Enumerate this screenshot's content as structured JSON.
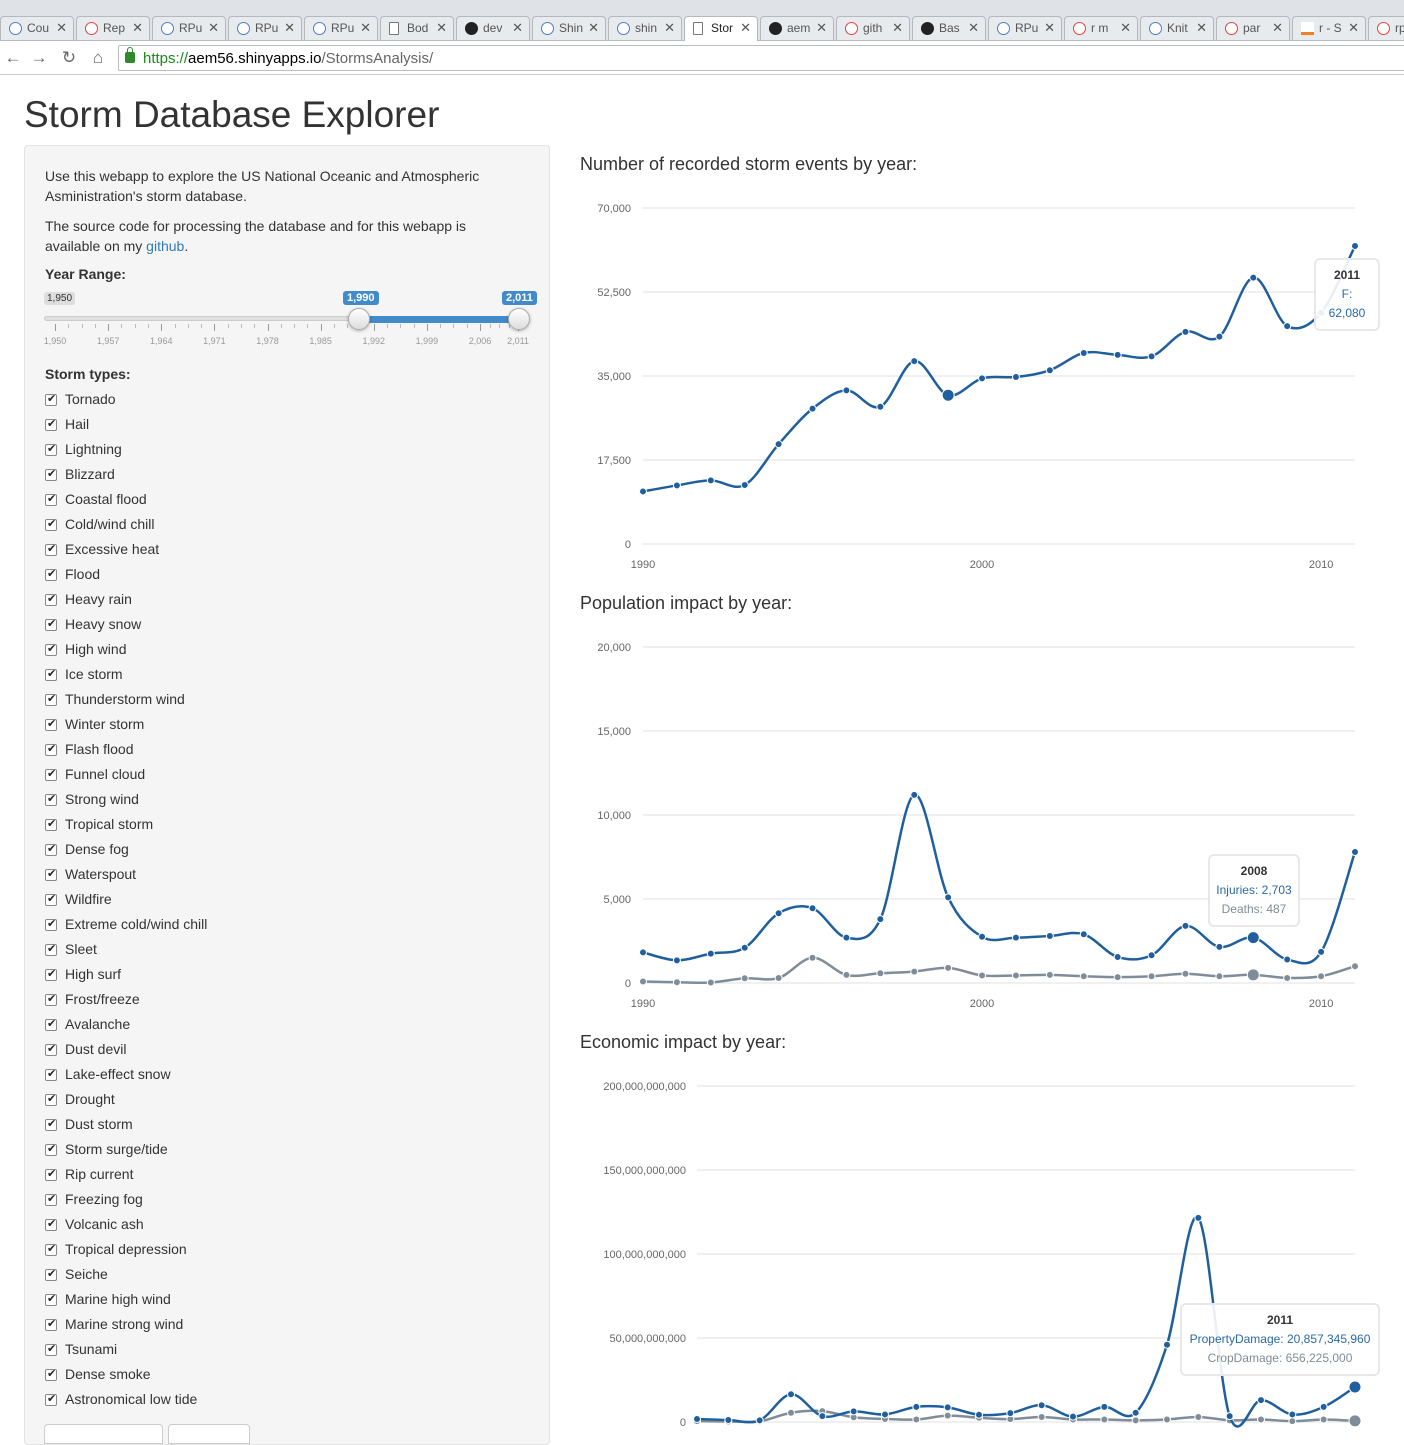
{
  "browser": {
    "tabs": [
      {
        "label": "Cou",
        "icon": "infinity-icon"
      },
      {
        "label": "Rep",
        "icon": "google-icon"
      },
      {
        "label": "RPu",
        "icon": "rstudio-icon"
      },
      {
        "label": "RPu",
        "icon": "rstudio-icon"
      },
      {
        "label": "RPu",
        "icon": "rstudio-icon"
      },
      {
        "label": "Bod",
        "icon": "document-icon"
      },
      {
        "label": "dev",
        "icon": "github-icon"
      },
      {
        "label": "Shin",
        "icon": "rstudio-icon"
      },
      {
        "label": "shin",
        "icon": "rstudio-icon"
      },
      {
        "label": "Stor",
        "icon": "document-icon",
        "active": true
      },
      {
        "label": "aem",
        "icon": "github-icon"
      },
      {
        "label": "gith",
        "icon": "google-icon"
      },
      {
        "label": "Bas",
        "icon": "github-icon"
      },
      {
        "label": "RPu",
        "icon": "rstudio-icon"
      },
      {
        "label": "r m",
        "icon": "google-icon"
      },
      {
        "label": "Knit",
        "icon": "knitr-icon"
      },
      {
        "label": "par",
        "icon": "google-icon"
      },
      {
        "label": "r - S",
        "icon": "stackoverflow-icon"
      },
      {
        "label": "rpr",
        "icon": "google-icon"
      }
    ],
    "url_scheme": "https://",
    "url_host": "aem56.shinyapps.io",
    "url_path": "/StormsAnalysis/"
  },
  "page": {
    "title": "Storm Database Explorer",
    "intro1": "Use this webapp to explore the US National Oceanic and Atmospheric Asministration's storm database.",
    "intro2_prefix": "The source code for processing the database and for this webapp is available on my ",
    "intro2_link": "github",
    "intro2_suffix": "."
  },
  "slider": {
    "label": "Year Range:",
    "min_label": "1,950",
    "max_label": "2,011",
    "from_label": "1,990",
    "to_label": "2,011",
    "min": 1950,
    "max": 2011,
    "from": 1990,
    "to": 2011,
    "grid_labels": [
      "1,950",
      "1,957",
      "1,964",
      "1,971",
      "1,978",
      "1,985",
      "1,992",
      "1,999",
      "2,006",
      "2,011"
    ]
  },
  "storm_types": {
    "label": "Storm types:",
    "items": [
      "Tornado",
      "Hail",
      "Lightning",
      "Blizzard",
      "Coastal flood",
      "Cold/wind chill",
      "Excessive heat",
      "Flood",
      "Heavy rain",
      "Heavy snow",
      "High wind",
      "Ice storm",
      "Thunderstorm wind",
      "Winter storm",
      "Flash flood",
      "Funnel cloud",
      "Strong wind",
      "Tropical storm",
      "Dense fog",
      "Waterspout",
      "Wildfire",
      "Extreme cold/wind chill",
      "Sleet",
      "High surf",
      "Frost/freeze",
      "Avalanche",
      "Dust devil",
      "Lake-effect snow",
      "Drought",
      "Dust storm",
      "Storm surge/tide",
      "Rip current",
      "Freezing fog",
      "Volcanic ash",
      "Tropical depression",
      "Seiche",
      "Marine high wind",
      "Marine strong wind",
      "Tsunami",
      "Dense smoke",
      "Astronomical low tide"
    ]
  },
  "colors": {
    "primary": "#1f5f9e",
    "secondary": "#7f8c99",
    "accent": "#428bca"
  },
  "chart_data": [
    {
      "type": "line",
      "title": "Number of recorded storm events by year:",
      "x": [
        1990,
        1991,
        1992,
        1993,
        1994,
        1995,
        1996,
        1997,
        1998,
        1999,
        2000,
        2001,
        2002,
        2003,
        2004,
        2005,
        2006,
        2007,
        2008,
        2009,
        2010,
        2011
      ],
      "series": [
        {
          "values": [
            10950,
            12200,
            13250,
            12300,
            20800,
            28200,
            32000,
            28600,
            38100,
            31000,
            34500,
            34800,
            36200,
            39800,
            39400,
            39100,
            44200,
            43200,
            55500,
            45400,
            48200,
            62080
          ]
        }
      ],
      "yticks": [
        "0",
        "17,500",
        "35,000",
        "52,500",
        "70,000"
      ],
      "ylim": [
        0,
        70000
      ],
      "xticks": [
        "1990",
        "2000",
        "2010"
      ],
      "tooltip": {
        "header": "2011",
        "line1": "F: 62,080"
      },
      "highlight_index": 9
    },
    {
      "type": "line",
      "title": "Population impact by year:",
      "x": [
        1990,
        1991,
        1992,
        1993,
        1994,
        1995,
        1996,
        1997,
        1998,
        1999,
        2000,
        2001,
        2002,
        2003,
        2004,
        2005,
        2006,
        2007,
        2008,
        2009,
        2010,
        2011
      ],
      "series": [
        {
          "name": "Injuries",
          "values": [
            1825,
            1350,
            1750,
            2100,
            4150,
            4450,
            2700,
            3800,
            11200,
            5100,
            2750,
            2700,
            2800,
            2900,
            1550,
            1650,
            3400,
            2150,
            2703,
            1400,
            1850,
            7800
          ]
        },
        {
          "name": "Deaths",
          "values": [
            90,
            45,
            30,
            280,
            300,
            1500,
            480,
            580,
            680,
            900,
            450,
            450,
            480,
            400,
            350,
            400,
            550,
            400,
            487,
            300,
            400,
            1000
          ]
        }
      ],
      "yticks": [
        "0",
        "5,000",
        "10,000",
        "15,000",
        "20,000"
      ],
      "ylim": [
        0,
        20000
      ],
      "xticks": [
        "1990",
        "2000",
        "2010"
      ],
      "tooltip": {
        "header": "2008",
        "line1": "Injuries: 2,703",
        "line2": "Deaths: 487"
      },
      "highlight_index": 18
    },
    {
      "type": "line",
      "title": "Economic impact by year:",
      "x": [
        1990,
        1991,
        1992,
        1993,
        1994,
        1995,
        1996,
        1997,
        1998,
        1999,
        2000,
        2001,
        2002,
        2003,
        2004,
        2005,
        2006,
        2007,
        2008,
        2009,
        2010,
        2011
      ],
      "series": [
        {
          "name": "PropertyDamage",
          "values": [
            1800000000,
            1200000000,
            1000000000,
            16500000000,
            3500000000,
            6300000000,
            4500000000,
            9000000000,
            8700000000,
            4300000000,
            5300000000,
            10000000000,
            3200000000,
            9000000000,
            5500000000,
            46000000000,
            121500000000,
            3500000000,
            13000000000,
            4500000000,
            9000000000,
            20857345960
          ]
        },
        {
          "name": "CropDamage",
          "values": [
            500000000,
            300000000,
            400000000,
            5500000000,
            6500000000,
            2800000000,
            1800000000,
            1500000000,
            3800000000,
            2500000000,
            1700000000,
            3000000000,
            1500000000,
            1500000000,
            1000000000,
            1500000000,
            3000000000,
            1000000000,
            1500000000,
            500000000,
            1500000000,
            656225000
          ]
        }
      ],
      "yticks": [
        "0",
        "50,000,000,000",
        "100,000,000,000",
        "150,000,000,000",
        "200,000,000,000"
      ],
      "ylim": [
        0,
        200000000000
      ],
      "tooltip": {
        "header": "2011",
        "line1": "PropertyDamage: 20,857,345,960",
        "line2": "CropDamage: 656,225,000"
      },
      "highlight_index": 21
    }
  ]
}
